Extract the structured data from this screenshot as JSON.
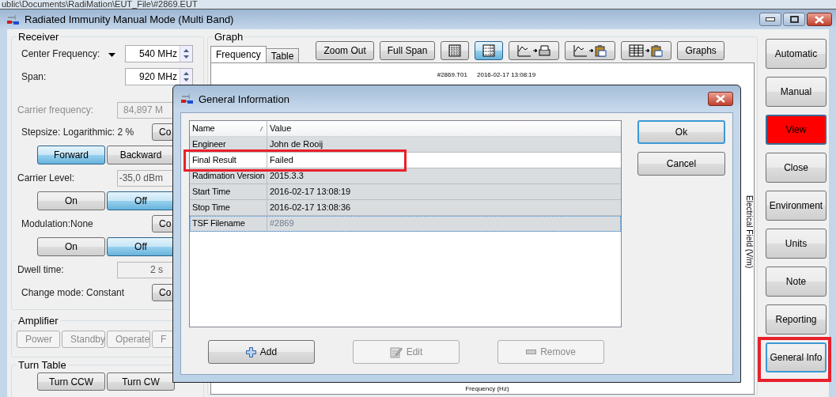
{
  "desktop": {
    "path": "ublic\\Documents\\RadiMation\\EUT_File\\#2869.EUT"
  },
  "window": {
    "title": "Radiated Immunity Manual Mode (Multi Band)"
  },
  "receiver": {
    "title": "Receiver",
    "items": [
      {
        "kind": "spin",
        "label": "Center Frequency:",
        "value": "540 MHz",
        "dropdown": true
      },
      {
        "kind": "spin",
        "label": "Span:",
        "value": "920 MHz",
        "dropdown": false
      },
      {
        "kind": "readout",
        "label": "Carrier frequency:",
        "value": "84,897 M",
        "disabled": true
      },
      {
        "kind": "setting",
        "label": "Stepsize: Logarithmic: 2 %",
        "button": "Co"
      },
      {
        "kind": "toggle",
        "options": [
          {
            "label": "Forward",
            "selected": true
          },
          {
            "label": "Backward",
            "selected": false
          }
        ]
      },
      {
        "kind": "readout",
        "label": "Carrier Level:",
        "value": "-35,0 dBm",
        "disabled": false
      },
      {
        "kind": "toggle",
        "options": [
          {
            "label": "On",
            "selected": false
          },
          {
            "label": "Off",
            "selected": true
          }
        ]
      },
      {
        "kind": "setting",
        "label": "Modulation:None",
        "button": "Co"
      },
      {
        "kind": "toggle",
        "options": [
          {
            "label": "On",
            "selected": false
          },
          {
            "label": "Off",
            "selected": true
          }
        ]
      },
      {
        "kind": "readout",
        "label": "Dwell time:",
        "value": "2 s",
        "disabled": false
      },
      {
        "kind": "setting",
        "label": "Change mode: Constant",
        "button": "Co"
      }
    ]
  },
  "amplifier": {
    "title": "Amplifier",
    "buttons": [
      {
        "label": "Power",
        "disabled": true
      },
      {
        "label": "Standby",
        "disabled": true
      },
      {
        "label": "Operate",
        "disabled": true
      },
      {
        "label": "F",
        "disabled": true
      }
    ]
  },
  "turn_table": {
    "title": "Turn Table",
    "buttons": [
      {
        "label": "Turn CCW",
        "disabled": false
      },
      {
        "label": "Turn CW",
        "disabled": false
      }
    ]
  },
  "graph": {
    "title": "Graph",
    "tabs": [
      {
        "label": "Frequency",
        "selected": true
      },
      {
        "label": "Table",
        "selected": false
      }
    ],
    "toolbar": [
      {
        "kind": "text",
        "label": "Zoom Out",
        "pressed": false
      },
      {
        "kind": "text",
        "label": "Full Span",
        "pressed": false
      },
      {
        "kind": "icon",
        "pressed": false
      },
      {
        "kind": "icon",
        "pressed": true
      },
      {
        "kind": "icon",
        "pressed": false
      },
      {
        "kind": "icon",
        "pressed": false
      },
      {
        "kind": "icon",
        "pressed": false
      },
      {
        "kind": "text",
        "label": "Graphs",
        "pressed": false
      }
    ],
    "plot": {
      "test_id": "#2869.T01",
      "timestamp": "2016-02-17 13:08:19",
      "ylabel": "Electrical Field (V/m)",
      "xlabel": "Frequency (Hz)"
    }
  },
  "side_buttons": [
    {
      "label": "Automatic",
      "alarm": false,
      "focused": false,
      "highlighted": false
    },
    {
      "label": "Manual",
      "alarm": false,
      "focused": false,
      "highlighted": false
    },
    {
      "label": "View",
      "alarm": true,
      "focused": false,
      "highlighted": false
    },
    {
      "label": "Close",
      "alarm": false,
      "focused": false,
      "highlighted": false
    },
    {
      "label": "Environment",
      "alarm": false,
      "focused": false,
      "highlighted": false
    },
    {
      "label": "Units",
      "alarm": false,
      "focused": false,
      "highlighted": false
    },
    {
      "label": "Note",
      "alarm": false,
      "focused": false,
      "highlighted": false
    },
    {
      "label": "Reporting",
      "alarm": false,
      "focused": false,
      "highlighted": false
    },
    {
      "label": "General Info",
      "alarm": false,
      "focused": true,
      "highlighted": true
    }
  ],
  "dialog": {
    "title": "General Information",
    "columns": [
      {
        "label": "Name",
        "sorted": true
      },
      {
        "label": "Value",
        "sorted": false
      }
    ],
    "rows": [
      {
        "name": "Engineer",
        "value": "John de Rooij",
        "editable": false,
        "selected": false,
        "highlighted": false
      },
      {
        "name": "Final Result",
        "value": "Failed",
        "editable": true,
        "selected": false,
        "highlighted": true
      },
      {
        "name": "Radimation Version",
        "value": "2015.3.3",
        "editable": false,
        "selected": false,
        "highlighted": false
      },
      {
        "name": "Start Time",
        "value": "2016-02-17 13:08:19",
        "editable": false,
        "selected": false,
        "highlighted": false
      },
      {
        "name": "Stop Time",
        "value": "2016-02-17 13:08:36",
        "editable": false,
        "selected": false,
        "highlighted": false
      },
      {
        "name": "TSF Filename",
        "value": "#2869",
        "editable": false,
        "selected": true,
        "highlighted": false
      }
    ],
    "side_buttons": [
      {
        "label": "Ok",
        "default": true
      },
      {
        "label": "Cancel",
        "default": false
      }
    ],
    "bottom_buttons": [
      {
        "kind": "add",
        "label": "Add",
        "disabled": false
      },
      {
        "kind": "edit",
        "label": "Edit",
        "disabled": true
      },
      {
        "kind": "remove",
        "label": "Remove",
        "disabled": true
      }
    ]
  }
}
